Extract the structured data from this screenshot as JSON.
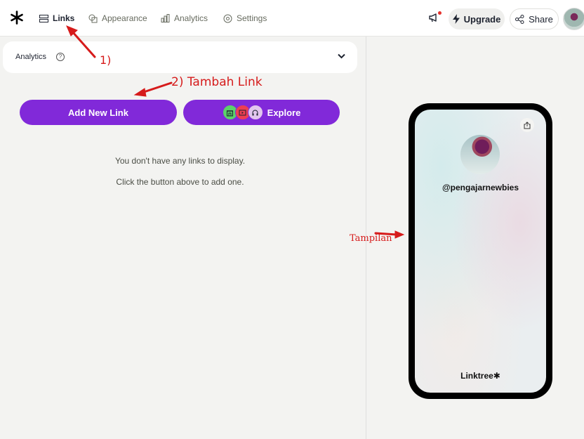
{
  "nav": {
    "links_label": "Links",
    "appearance_label": "Appearance",
    "analytics_label": "Analytics",
    "settings_label": "Settings",
    "upgrade_label": "Upgrade",
    "share_label": "Share",
    "icons": [
      "linktree-logo-icon",
      "links-icon",
      "appearance-icon",
      "analytics-icon",
      "settings-icon",
      "megaphone-icon",
      "bolt-icon",
      "share-icon"
    ]
  },
  "analytics_card": {
    "label": "Analytics",
    "help": "?"
  },
  "actions": {
    "add_label": "Add New Link",
    "explore_label": "Explore"
  },
  "empty_state": {
    "line1": "You don't have any links to display.",
    "line2": "Click the button above to add one."
  },
  "annotations": {
    "a1": "1)",
    "a2": "2) Tambah Link",
    "a3": "Tampilan"
  },
  "preview": {
    "handle": "@pengajarnewbies",
    "brand": "Linktree✱"
  },
  "colors": {
    "accent": "#8129d9",
    "annotation": "#d61b1b",
    "background": "#f3f3f1"
  }
}
